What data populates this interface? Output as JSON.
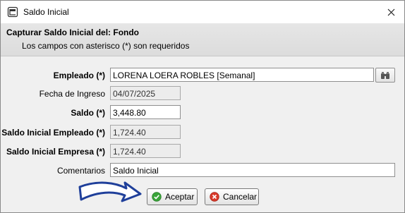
{
  "window": {
    "title": "Saldo Inicial",
    "close_glyph": "✕",
    "icon": "window-app-icon"
  },
  "header": {
    "title": "Capturar Saldo Inicial del: Fondo",
    "subtitle": "Los campos con asterisco (*) son requeridos"
  },
  "form": {
    "empleado": {
      "label": "Empleado (*)",
      "value": "LORENA LOERA ROBLES [Semanal]"
    },
    "fecha_ingreso": {
      "label": "Fecha de Ingreso",
      "value": "04/07/2025"
    },
    "saldo": {
      "label": "Saldo (*)",
      "value": "3,448.80"
    },
    "saldo_empleado": {
      "label": "Saldo Inicial Empleado (*)",
      "value": "1,724.40"
    },
    "saldo_empresa": {
      "label": "Saldo Inicial Empresa (*)",
      "value": "1,724.40"
    },
    "comentarios": {
      "label": "Comentarios",
      "value": "Saldo Inicial"
    }
  },
  "buttons": {
    "accept": {
      "label": "Aceptar",
      "icon": "check-circle-icon",
      "color": "#3aa53a"
    },
    "cancel": {
      "label": "Cancelar",
      "icon": "cancel-circle-icon",
      "color": "#d93a2b"
    }
  },
  "annotation": {
    "icon": "pointing-arrow-icon",
    "color": "#1f3f9a"
  }
}
